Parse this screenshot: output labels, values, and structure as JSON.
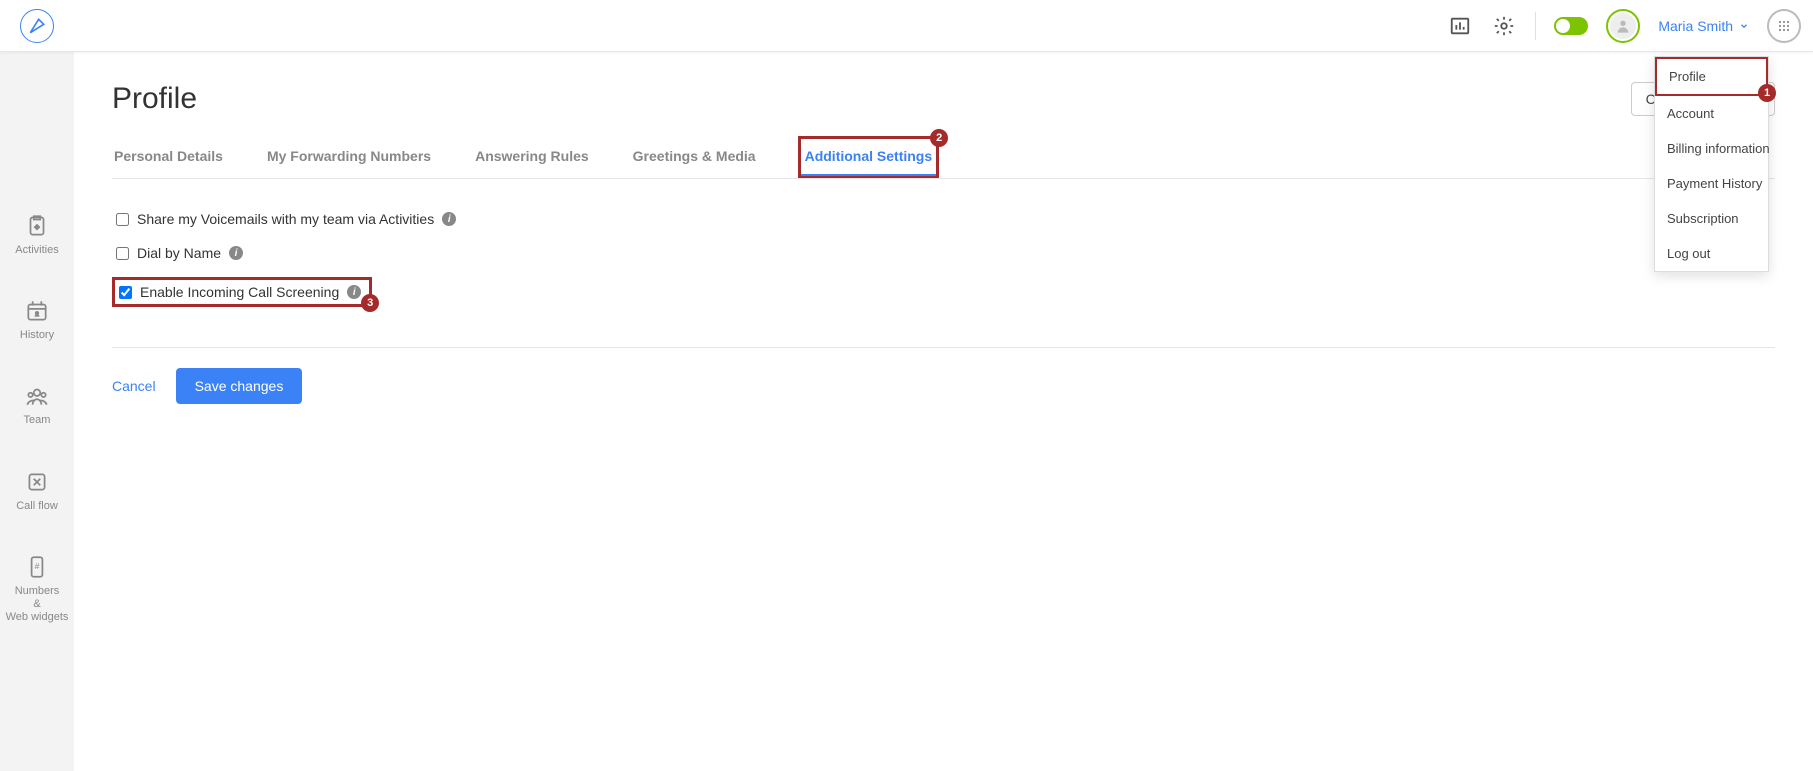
{
  "header": {
    "username": "Maria Smith"
  },
  "dropdown": {
    "items": [
      {
        "label": "Profile",
        "highlighted": true,
        "badge": "1"
      },
      {
        "label": "Account"
      },
      {
        "label": "Billing information"
      },
      {
        "label": "Payment History"
      },
      {
        "label": "Subscription"
      },
      {
        "label": "Log out"
      }
    ]
  },
  "sidebar": {
    "items": [
      {
        "label": "Activities"
      },
      {
        "label": "History"
      },
      {
        "label": "Team"
      },
      {
        "label": "Call flow"
      },
      {
        "label": "Numbers\n&\nWeb widgets"
      }
    ]
  },
  "page": {
    "title": "Profile",
    "change_password": "Change Password"
  },
  "tabs": [
    {
      "label": "Personal Details",
      "active": false
    },
    {
      "label": "My Forwarding Numbers",
      "active": false
    },
    {
      "label": "Answering Rules",
      "active": false
    },
    {
      "label": "Greetings & Media",
      "active": false
    },
    {
      "label": "Additional Settings",
      "active": true,
      "highlighted": true,
      "badge": "2"
    }
  ],
  "settings": [
    {
      "label": "Share my Voicemails with my team via Activities",
      "checked": false,
      "info": true
    },
    {
      "label": "Dial by Name",
      "checked": false,
      "info": true
    },
    {
      "label": "Enable Incoming Call Screening",
      "checked": true,
      "info": true,
      "highlighted": true,
      "badge": "3"
    }
  ],
  "actions": {
    "cancel": "Cancel",
    "save": "Save changes"
  }
}
